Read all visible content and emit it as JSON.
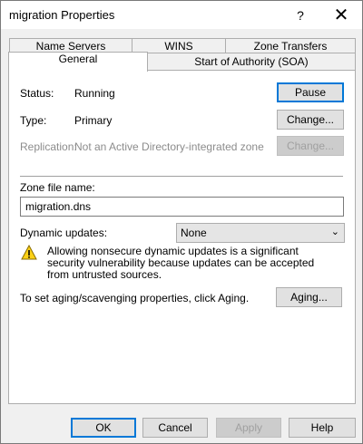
{
  "window": {
    "title": "migration Properties",
    "help_glyph": "?",
    "close_glyph": "✕"
  },
  "tabs": {
    "row1": [
      "Name Servers",
      "WINS",
      "Zone Transfers"
    ],
    "row2": [
      "General",
      "Start of Authority (SOA)"
    ],
    "active": "General"
  },
  "general": {
    "status_label": "Status:",
    "status_value": "Running",
    "pause_button": "Pause",
    "type_label": "Type:",
    "type_value": "Primary",
    "type_change_button": "Change...",
    "replication_label": "Replication:",
    "replication_value": "Not an Active Directory-integrated zone",
    "replication_change_button": "Change...",
    "zone_file_label": "Zone file name:",
    "zone_file_value": "migration.dns",
    "dynamic_updates_label": "Dynamic updates:",
    "dynamic_updates_value": "None",
    "warning_text": "Allowing nonsecure dynamic updates is a significant security vulnerability because updates can be accepted from untrusted sources.",
    "aging_text": "To set aging/scavenging properties, click Aging.",
    "aging_button": "Aging..."
  },
  "footer": {
    "ok": "OK",
    "cancel": "Cancel",
    "apply": "Apply",
    "help": "Help"
  }
}
